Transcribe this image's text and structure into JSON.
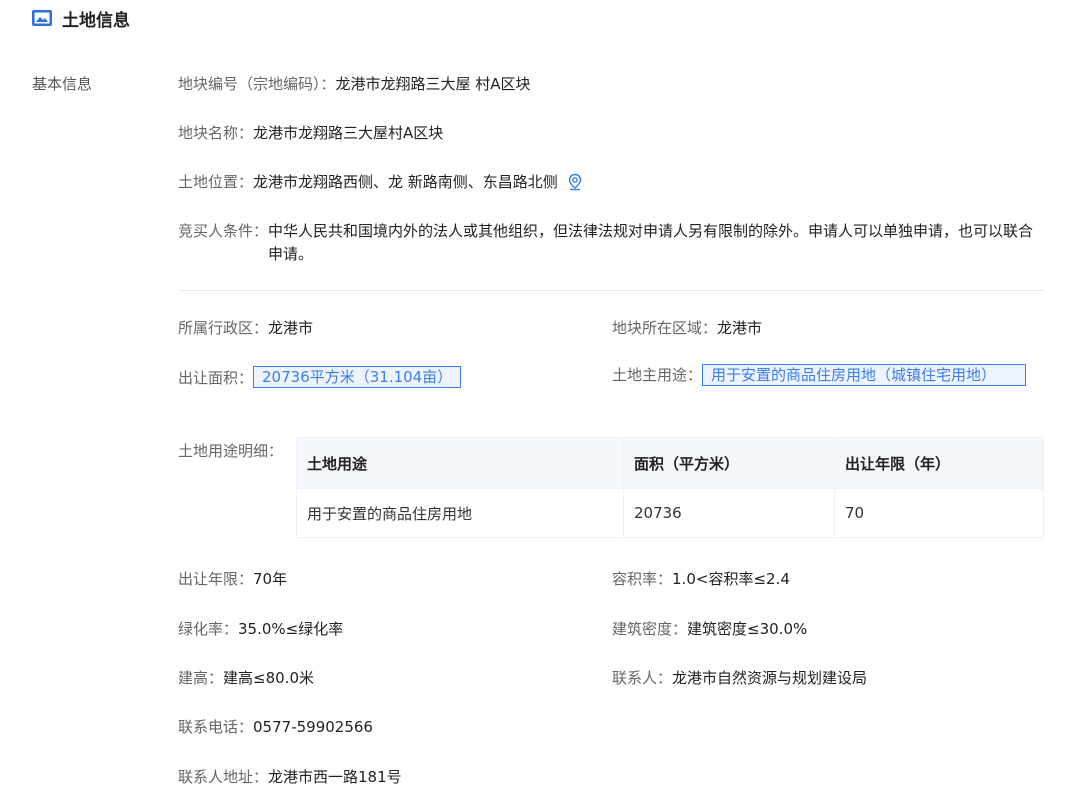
{
  "header": {
    "title": "土地信息",
    "icon": "image-icon"
  },
  "section": {
    "label": "基本信息"
  },
  "fields": {
    "parcel_code": {
      "label": "地块编号（宗地编码）：",
      "value": "龙港市龙翔路三大屋 村A区块"
    },
    "parcel_name": {
      "label": "地块名称：",
      "value": "龙港市龙翔路三大屋村A区块"
    },
    "location": {
      "label": "土地位置：",
      "value": "龙港市龙翔路西侧、龙 新路南侧、东昌路北侧",
      "icon": "map-pin-icon"
    },
    "bidder": {
      "label": "竞买人条件：",
      "value": "中华人民共和国境内外的法人或其他组织，但法律法规对申请人另有限制的除外。申请人可以单独申请，也可以联合申请。"
    },
    "district": {
      "label": "所属行政区：",
      "value": "龙港市"
    },
    "area_region": {
      "label": "地块所在区域：",
      "value": "龙港市"
    },
    "transfer_area": {
      "label": "出让面积：",
      "value": "20736平方米（31.104亩）"
    },
    "main_use": {
      "label": "土地主用途：",
      "value": "用于安置的商品住房用地（城镇住宅用地）"
    },
    "use_detail": {
      "label": "土地用途明细："
    },
    "term": {
      "label": "出让年限：",
      "value": "70年"
    },
    "far": {
      "label": "容积率：",
      "value": "1.0<容积率≤2.4"
    },
    "green": {
      "label": "绿化率：",
      "value": "35.0%≤绿化率"
    },
    "density": {
      "label": "建筑密度：",
      "value": "建筑密度≤30.0%"
    },
    "height": {
      "label": "建高：",
      "value": "建高≤80.0米"
    },
    "contact": {
      "label": "联系人：",
      "value": "龙港市自然资源与规划建设局"
    },
    "phone": {
      "label": "联系电话：",
      "value": "0577-59902566"
    },
    "address": {
      "label": "联系人地址：",
      "value": "龙港市西一路181号"
    }
  },
  "use_table": {
    "headers": [
      "土地用途",
      "面积（平方米）",
      "出让年限（年）"
    ],
    "rows": [
      [
        "用于安置的商品住房用地",
        "20736",
        "70"
      ]
    ]
  },
  "colors": {
    "accent": "#3b7ded",
    "accent_bg": "#eef4ff",
    "table_header_bg": "#f4f7fc"
  }
}
